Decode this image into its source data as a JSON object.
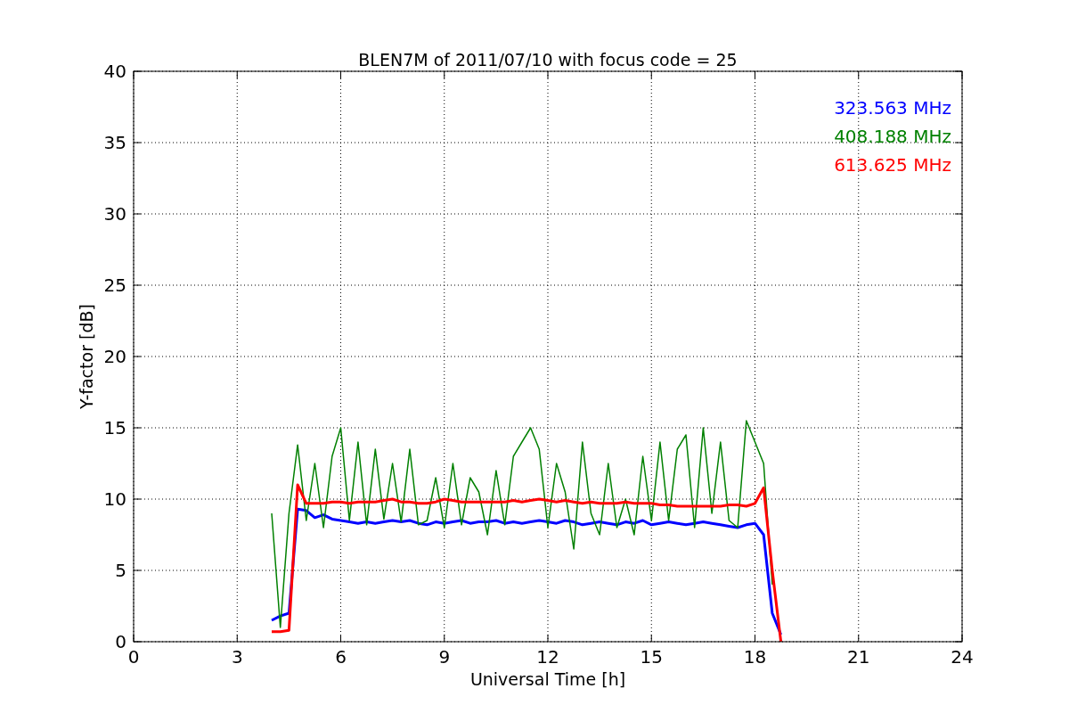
{
  "chart_data": {
    "type": "line",
    "grid": true,
    "title": "BLEN7M of 2011/07/10 with focus code = 25",
    "xlabel": "Universal Time [h]",
    "ylabel": "Y-factor [dB]",
    "xlim": [
      0,
      24
    ],
    "ylim": [
      0,
      40
    ],
    "xticks": [
      0,
      3,
      6,
      9,
      12,
      15,
      18,
      21,
      24
    ],
    "yticks": [
      0,
      5,
      10,
      15,
      20,
      25,
      30,
      35,
      40
    ],
    "x": [
      4.0,
      4.25,
      4.5,
      4.75,
      5.0,
      5.25,
      5.5,
      5.75,
      6.0,
      6.25,
      6.5,
      6.75,
      7.0,
      7.25,
      7.5,
      7.75,
      8.0,
      8.25,
      8.5,
      8.75,
      9.0,
      9.25,
      9.5,
      9.75,
      10.0,
      10.25,
      10.5,
      10.75,
      11.0,
      11.25,
      11.5,
      11.75,
      12.0,
      12.25,
      12.5,
      12.75,
      13.0,
      13.25,
      13.5,
      13.75,
      14.0,
      14.25,
      14.5,
      14.75,
      15.0,
      15.25,
      15.5,
      15.75,
      16.0,
      16.25,
      16.5,
      16.75,
      17.0,
      17.25,
      17.5,
      17.75,
      18.0,
      18.25,
      18.5,
      18.75
    ],
    "series": [
      {
        "name": "323.563 MHz",
        "color": "#0000ff",
        "values": [
          1.5,
          1.8,
          2.0,
          9.3,
          9.2,
          8.7,
          8.9,
          8.6,
          8.5,
          8.4,
          8.3,
          8.4,
          8.3,
          8.4,
          8.5,
          8.4,
          8.5,
          8.3,
          8.2,
          8.4,
          8.3,
          8.4,
          8.5,
          8.3,
          8.4,
          8.4,
          8.5,
          8.3,
          8.4,
          8.3,
          8.4,
          8.5,
          8.4,
          8.3,
          8.5,
          8.4,
          8.2,
          8.3,
          8.4,
          8.3,
          8.2,
          8.4,
          8.3,
          8.5,
          8.2,
          8.3,
          8.4,
          8.3,
          8.2,
          8.3,
          8.4,
          8.3,
          8.2,
          8.1,
          8.0,
          8.2,
          8.3,
          7.5,
          2.0,
          0.5
        ]
      },
      {
        "name": "408.188 MHz",
        "color": "#008000",
        "values": [
          9.0,
          1.0,
          9.0,
          13.8,
          8.5,
          12.5,
          8.0,
          13.0,
          15.0,
          8.5,
          14.0,
          8.2,
          13.5,
          8.6,
          12.5,
          8.4,
          13.5,
          8.2,
          8.5,
          11.5,
          8.0,
          12.5,
          8.2,
          11.5,
          10.5,
          7.5,
          12.0,
          8.2,
          13.0,
          14.0,
          15.0,
          13.5,
          8.0,
          12.5,
          10.5,
          6.5,
          14.0,
          9.0,
          7.5,
          12.5,
          8.0,
          10.0,
          7.5,
          13.0,
          8.5,
          14.0,
          8.5,
          13.5,
          14.5,
          8.0,
          15.0,
          9.0,
          14.0,
          8.5,
          8.0,
          15.5,
          14.0,
          12.5,
          4.0,
          null
        ]
      },
      {
        "name": "613.625 MHz",
        "color": "#ff0000",
        "values": [
          0.7,
          0.7,
          0.8,
          11.0,
          9.7,
          9.7,
          9.7,
          9.8,
          9.8,
          9.7,
          9.8,
          9.8,
          9.8,
          9.9,
          10.0,
          9.8,
          9.8,
          9.7,
          9.7,
          9.8,
          10.0,
          9.9,
          9.8,
          9.8,
          9.8,
          9.8,
          9.8,
          9.8,
          9.9,
          9.8,
          9.9,
          10.0,
          9.9,
          9.8,
          9.9,
          9.8,
          9.7,
          9.8,
          9.7,
          9.7,
          9.7,
          9.8,
          9.7,
          9.7,
          9.7,
          9.6,
          9.6,
          9.5,
          9.5,
          9.5,
          9.5,
          9.5,
          9.5,
          9.6,
          9.6,
          9.5,
          9.7,
          10.8,
          5.0,
          0.0
        ]
      }
    ]
  }
}
